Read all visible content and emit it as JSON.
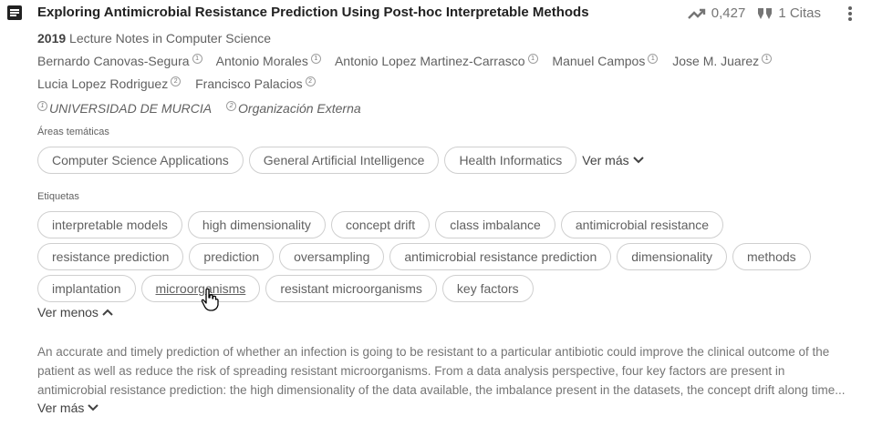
{
  "title": "Exploring Antimicrobial Resistance Prediction Using Post-hoc Interpretable Methods",
  "metrics": {
    "score": "0,427",
    "citations": "1 Citas"
  },
  "publication": {
    "year": "2019",
    "venue": "Lecture Notes in Computer Science"
  },
  "authors": [
    {
      "name": "Bernardo Canovas-Segura",
      "aff": "1"
    },
    {
      "name": "Antonio Morales",
      "aff": "1"
    },
    {
      "name": "Antonio Lopez Martinez-Carrasco",
      "aff": "1"
    },
    {
      "name": "Manuel Campos",
      "aff": "1"
    },
    {
      "name": "Jose M. Juarez",
      "aff": "1"
    },
    {
      "name": "Lucia Lopez Rodriguez",
      "aff": "2"
    },
    {
      "name": "Francisco Palacios",
      "aff": "2"
    }
  ],
  "affiliations": [
    {
      "num": "1",
      "name": "UNIVERSIDAD DE MURCIA"
    },
    {
      "num": "2",
      "name": "Organización Externa"
    }
  ],
  "areas": {
    "label": "Áreas temáticas",
    "items": [
      "Computer Science Applications",
      "General Artificial Intelligence",
      "Health Informatics"
    ],
    "more": "Ver más"
  },
  "tags": {
    "label": "Etiquetas",
    "rows": [
      [
        "interpretable models",
        "high dimensionality",
        "concept drift",
        "class imbalance",
        "antimicrobial resistance"
      ],
      [
        "resistance prediction",
        "prediction",
        "oversampling",
        "antimicrobial resistance prediction",
        "dimensionality",
        "methods"
      ],
      [
        "implantation",
        "microorganisms",
        "resistant microorganisms",
        "key factors"
      ]
    ],
    "less": "Ver menos"
  },
  "abstract": {
    "lines": [
      "An accurate and timely prediction of whether an infection is going to be resistant to a particular antibiotic could improve the clinical outcome of the",
      "patient as well as reduce the risk of spreading resistant microorganisms. From a data analysis perspective, four key factors are present in",
      "antimicrobial resistance prediction: the high dimensionality of the data available, the imbalance present in the datasets, the concept drift along time..."
    ],
    "more": "Ver más"
  },
  "icons": {
    "doc": "document-icon",
    "trend": "trending-up-icon",
    "quote": "quote-icon",
    "menu": "more-vert-icon"
  }
}
